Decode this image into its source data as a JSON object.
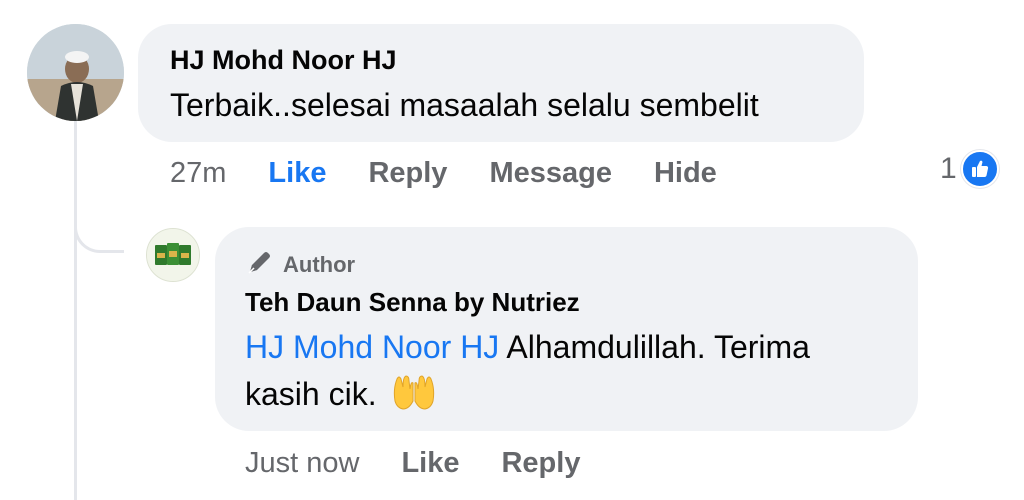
{
  "comment": {
    "author": "HJ Mohd Noor HJ",
    "text": "Terbaik..selesai masaalah selalu sembelit",
    "time": "27m",
    "actions": {
      "like": "Like",
      "reply": "Reply",
      "message": "Message",
      "hide": "Hide"
    },
    "reaction_count": "1",
    "reaction_icon": "thumbs-up-icon"
  },
  "reply": {
    "badge_label": "Author",
    "badge_icon": "pencil-icon",
    "author": "Teh Daun Senna by Nutriez",
    "mention": "HJ Mohd Noor HJ",
    "text_line1": "Alhamdulillah. Terima",
    "text_line2": "kasih cik.",
    "emoji": "raising-hands-emoji",
    "time": "Just now",
    "actions": {
      "like": "Like",
      "reply": "Reply"
    }
  },
  "colors": {
    "accent": "#1877f2",
    "bubble": "#f0f2f5",
    "muted": "#65676b",
    "text": "#050505"
  }
}
